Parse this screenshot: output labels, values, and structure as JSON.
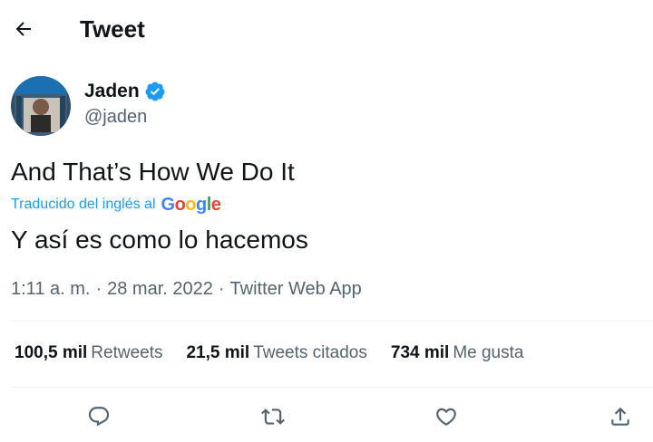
{
  "header": {
    "title": "Tweet",
    "back_icon": "arrow-left-icon"
  },
  "author": {
    "name": "Jaden",
    "handle": "@jaden",
    "verified_color": "#1d9bf0"
  },
  "tweet": {
    "text": "And That’s How We Do It",
    "translation_label": "Traducido del inglés al",
    "translation_provider": "Google",
    "translated_text": "Y así es como lo hacemos"
  },
  "meta": {
    "time": "1:11 a. m.",
    "separator": "·",
    "date": "28 mar. 2022",
    "source": "Twitter Web App"
  },
  "stats": {
    "retweets": {
      "count": "100,5 mil",
      "label": "Retweets"
    },
    "quotes": {
      "count": "21,5 mil",
      "label": "Tweets citados"
    },
    "likes": {
      "count": "734 mil",
      "label": "Me gusta"
    }
  },
  "actions": [
    "reply-icon",
    "retweet-icon",
    "like-icon",
    "share-icon"
  ],
  "colors": {
    "accent": "#1d9bf0",
    "secondary_text": "#536471",
    "divider": "#eff3f4"
  }
}
